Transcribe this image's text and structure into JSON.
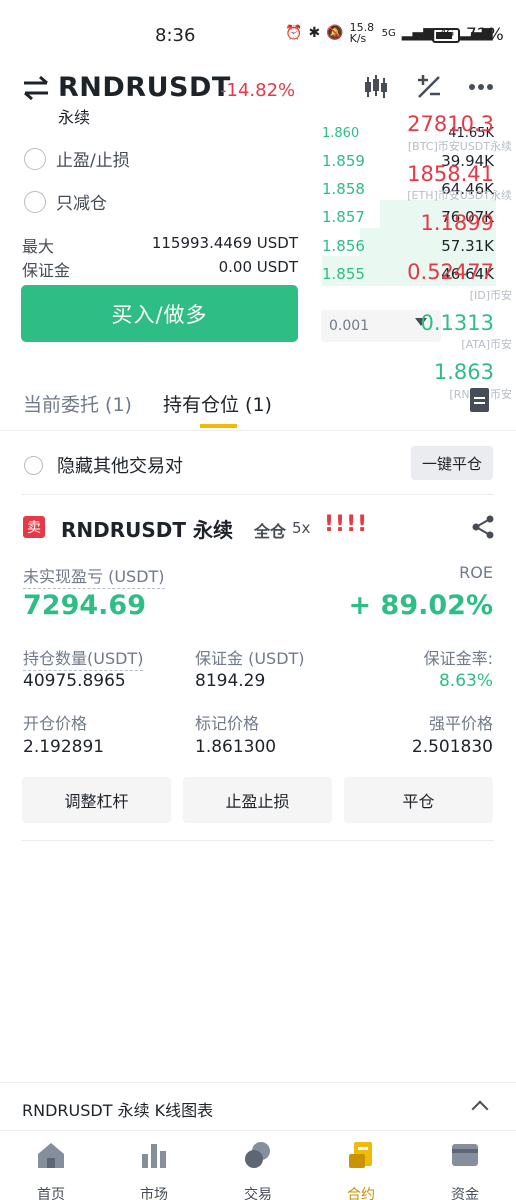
{
  "status_bar": {
    "time": "8:36",
    "net_speed": "15.8 K/s",
    "signal1": "5G",
    "signal2": "4G",
    "battery": "72%"
  },
  "header": {
    "symbol": "RNDRUSDT",
    "change": "-14.82%",
    "subtitle": "永续",
    "icons": [
      "candlestick-chart-icon",
      "plus-minus-icon",
      "more-icon"
    ]
  },
  "order_form": {
    "option_tp_sl": "止盈/止损",
    "option_reduce_only": "只减仓",
    "max_label": "最大",
    "max_value": "115993.4469 USDT",
    "margin_label": "保证金",
    "margin_value": "0.00 USDT",
    "buy_button": "买入/做多",
    "qty_value": "0.001"
  },
  "orderbook": {
    "top_price": "1.860",
    "top_volume": "41.65K",
    "rows": [
      {
        "price": "1.859",
        "volume": "39.94K"
      },
      {
        "price": "1.858",
        "volume": "64.46K"
      },
      {
        "price": "1.857",
        "volume": "76.07K"
      },
      {
        "price": "1.856",
        "volume": "57.31K"
      },
      {
        "price": "1.855",
        "volume": "46.64K"
      }
    ]
  },
  "floating_watchlist": {
    "items": [
      {
        "price": "27810.3",
        "label": "[BTC]币安USDT永续",
        "color": "#e63946"
      },
      {
        "price": "1858.41",
        "label": "[ETH]币安USDT永续",
        "color": "#e63946"
      },
      {
        "price": "1.1899",
        "label": "",
        "color": "#e63946"
      },
      {
        "price": "0.52477",
        "label": "[ID]币安",
        "color": "#e63946"
      },
      {
        "price": "0.1313",
        "label": "[ATA]币安",
        "color": "#2ebd85"
      },
      {
        "price": "1.863",
        "label": "[RNDR]币安",
        "color": "#2ebd85"
      }
    ]
  },
  "tabs": {
    "open_orders": "当前委托 (1)",
    "positions": "持有仓位 (1)"
  },
  "filters": {
    "hide_other_pairs": "隐藏其他交易对",
    "close_all_button": "一键平仓"
  },
  "position": {
    "side_badge": "卖",
    "title": "RNDRUSDT 永续",
    "margin_mode": "全仓",
    "leverage": "5x",
    "warning": "!!!!",
    "pnl_label": "未实现盈亏 (USDT)",
    "pnl_value": "7294.69",
    "roe_label": "ROE",
    "roe_value": "+ 89.02%",
    "size_label": "持仓数量(USDT)",
    "size_value": "40975.8965",
    "margin_label": "保证金 (USDT)",
    "margin_value": "8194.29",
    "margin_ratio_label": "保证金率:",
    "margin_ratio_value": "8.63%",
    "entry_label": "开仓价格",
    "entry_value": "2.192891",
    "mark_label": "标记价格",
    "mark_value": "1.861300",
    "liq_label": "强平价格",
    "liq_value": "2.501830",
    "btn_leverage": "调整杠杆",
    "btn_tpsl": "止盈止损",
    "btn_close": "平仓"
  },
  "kline_bar": {
    "text": "RNDRUSDT 永续  K线图表"
  },
  "bottom_nav": {
    "items": [
      {
        "label": "首页",
        "icon": "home-icon"
      },
      {
        "label": "市场",
        "icon": "market-icon"
      },
      {
        "label": "交易",
        "icon": "trade-icon"
      },
      {
        "label": "合约",
        "icon": "futures-icon"
      },
      {
        "label": "资金",
        "icon": "wallet-icon"
      }
    ],
    "active_index": 3,
    "active_color": "#f0b90b"
  }
}
